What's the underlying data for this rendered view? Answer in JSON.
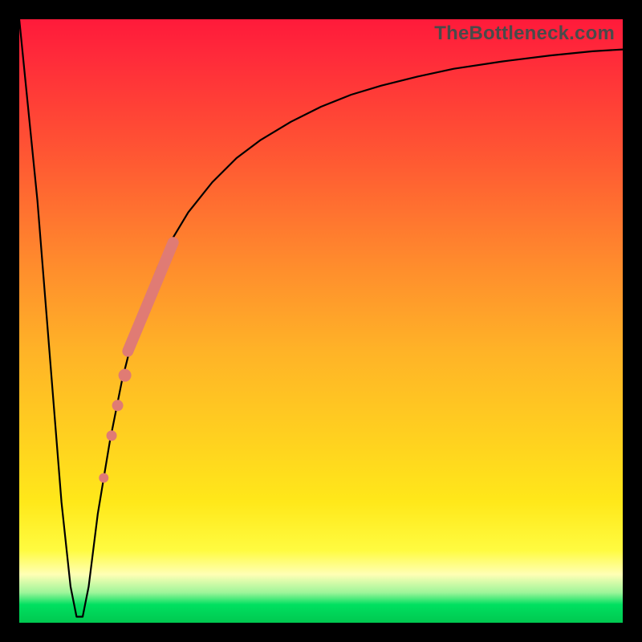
{
  "watermark": "TheBottleneck.com",
  "colors": {
    "frame": "#000000",
    "curve": "#000000",
    "markers": "#e07b74",
    "gradient_stops": [
      "#ff1a3a",
      "#ff2a3a",
      "#ff5533",
      "#ff8a2d",
      "#ffb327",
      "#ffd21f",
      "#ffe81a",
      "#fffb40",
      "#ffffb5",
      "#9ef59a",
      "#00e060",
      "#00c850"
    ]
  },
  "chart_data": {
    "type": "line",
    "title": "",
    "xlabel": "",
    "ylabel": "",
    "xlim": [
      0,
      100
    ],
    "ylim": [
      0,
      100
    ],
    "series": [
      {
        "name": "bottleneck-curve",
        "x": [
          0,
          3,
          5,
          7,
          8.5,
          9.5,
          10.5,
          11.5,
          13,
          15,
          17,
          19,
          21,
          23,
          25,
          28,
          32,
          36,
          40,
          45,
          50,
          55,
          60,
          66,
          72,
          80,
          88,
          95,
          100
        ],
        "y": [
          100,
          70,
          45,
          20,
          6,
          1,
          1,
          6,
          18,
          30,
          40,
          48,
          54,
          59,
          63,
          68,
          73,
          77,
          80,
          83,
          85.5,
          87.5,
          89,
          90.5,
          91.8,
          93,
          94,
          94.7,
          95
        ]
      }
    ],
    "flat_bottom": {
      "x_start": 8.5,
      "x_end": 11,
      "y": 1
    },
    "markers": {
      "name": "highlighted-range",
      "stroke_segment": {
        "x1": 18,
        "y1": 45,
        "x2": 25.5,
        "y2": 63
      },
      "dots": [
        {
          "x": 17.5,
          "y": 41
        },
        {
          "x": 16.3,
          "y": 36
        },
        {
          "x": 15.3,
          "y": 31
        },
        {
          "x": 14.0,
          "y": 24
        }
      ]
    }
  }
}
